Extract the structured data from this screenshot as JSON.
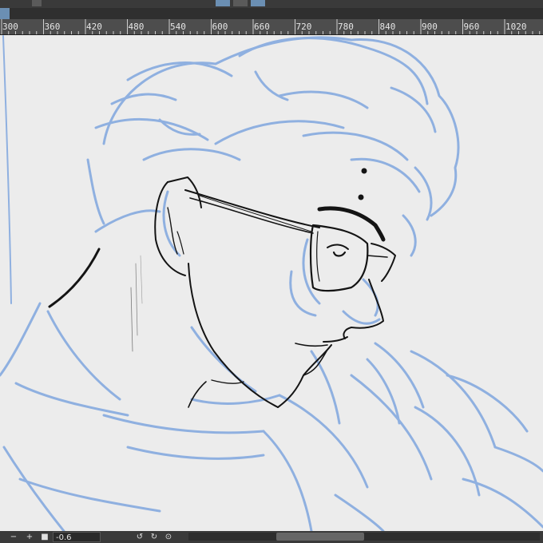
{
  "ruler": {
    "ticks": [
      "300",
      "360",
      "420",
      "480",
      "540",
      "600",
      "660",
      "720",
      "780",
      "840",
      "900",
      "960",
      "1020"
    ]
  },
  "statusbar": {
    "minus_label": "−",
    "plus_label": "+",
    "zoom_value": "-0.6",
    "rotate_left_icon": "rotate-ccw",
    "rotate_right_icon": "rotate-cw",
    "reset_icon": "rotate-reset"
  },
  "colors": {
    "sketch_blue": "#8fb0e0",
    "ink": "#141414",
    "canvas": "#ececec"
  }
}
